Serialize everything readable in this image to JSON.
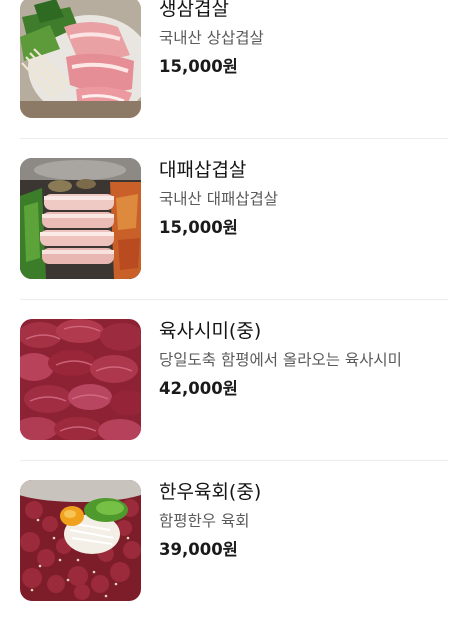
{
  "menu": {
    "items": [
      {
        "name": "생삼겹살",
        "description": "국내산 상삽겹살",
        "price": "15,000원",
        "image_icon": "pork-belly-photo"
      },
      {
        "name": "대패삽겹살",
        "description": "국내산 대패삽겹살",
        "price": "15,000원",
        "image_icon": "thin-pork-belly-photo"
      },
      {
        "name": "육사시미(중)",
        "description": "당일도축 함평에서 올라오는 육사시미",
        "price": "42,000원",
        "image_icon": "raw-beef-slices-photo"
      },
      {
        "name": "한우육회(중)",
        "description": "함평한우 육회",
        "price": "39,000원",
        "image_icon": "beef-tartare-photo"
      }
    ]
  }
}
